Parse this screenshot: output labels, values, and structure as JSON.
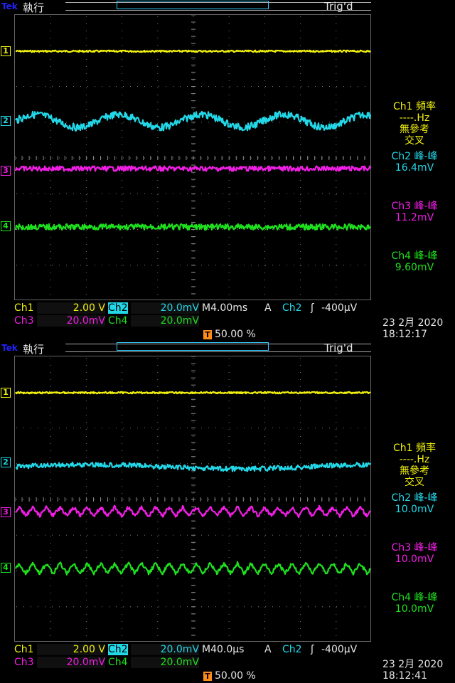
{
  "colors": {
    "ch1": "#f2f20d",
    "ch2": "#22d8e8",
    "ch3": "#f21ee6",
    "ch4": "#1ee01e",
    "trigger": "#ff8c1a",
    "text": "#e6e6e6"
  },
  "screens": [
    {
      "brand": "Tek",
      "mode": "執行",
      "status": "Trig'd",
      "measurements": {
        "ch1_title": "Ch1 頻率",
        "ch1_value": "----.Hz",
        "ch1_note1": "無參考",
        "ch1_note2": "交叉",
        "ch2_title": "Ch2 峰-峰",
        "ch2_value": "16.4mV",
        "ch3_title": "Ch3 峰-峰",
        "ch3_value": "11.2mV",
        "ch4_title": "Ch4 峰-峰",
        "ch4_value": "9.60mV"
      },
      "settings": {
        "ch1_label": "Ch1",
        "ch1_scale": "2.00 V",
        "ch2_label": "Ch2",
        "ch2_scale": "20.0mV",
        "ch3_label": "Ch3",
        "ch3_scale": "20.0mV",
        "ch4_label": "Ch4",
        "ch4_scale": "20.0mV",
        "timebase": "M4.00ms",
        "acq": "A",
        "trig_source": "Ch2",
        "trig_level": "-400μV",
        "trig_position": "50.00 %"
      },
      "date": "23 2月  2020",
      "time": "18:12:17",
      "waves": {
        "ch2_cycles": 4.3,
        "ch3_cycles": 0,
        "ch4_cycles": 0
      }
    },
    {
      "brand": "Tek",
      "mode": "執行",
      "status": "Trig'd",
      "measurements": {
        "ch1_title": "Ch1 頻率",
        "ch1_value": "----.Hz",
        "ch1_note1": "無參考",
        "ch1_note2": "交叉",
        "ch2_title": "Ch2 峰-峰",
        "ch2_value": "10.0mV",
        "ch3_title": "Ch3 峰-峰",
        "ch3_value": "10.0mV",
        "ch4_title": "Ch4 峰-峰",
        "ch4_value": "10.0mV"
      },
      "settings": {
        "ch1_label": "Ch1",
        "ch1_scale": "2.00 V",
        "ch2_label": "Ch2",
        "ch2_scale": "20.0mV",
        "ch3_label": "Ch3",
        "ch3_scale": "20.0mV",
        "ch4_label": "Ch4",
        "ch4_scale": "20.0mV",
        "timebase": "M40.0μs",
        "acq": "A",
        "trig_source": "Ch2",
        "trig_level": "-400μV",
        "trig_position": "50.00 %"
      },
      "date": "23 2月  2020",
      "time": "18:12:41",
      "waves": {
        "ch2_cycles": 1.2,
        "ch3_cycles": 26,
        "ch4_cycles": 26
      }
    }
  ],
  "channel_markers": [
    "1",
    "2",
    "3",
    "4"
  ],
  "trigger_marker": "T"
}
